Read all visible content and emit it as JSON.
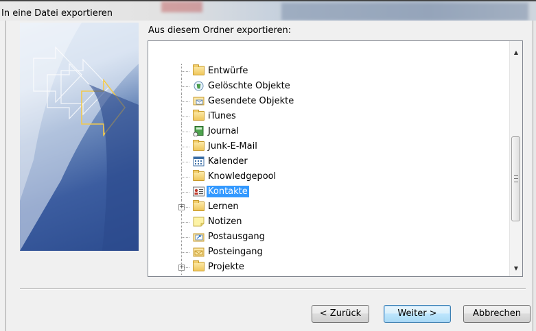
{
  "window": {
    "title": "In eine Datei exportieren"
  },
  "main": {
    "folder_label": "Aus diesem Ordner exportieren:"
  },
  "tree": {
    "selected": "Kontakte",
    "items": [
      {
        "label": "Entwürfe",
        "icon": "folder-icon",
        "expandable": false
      },
      {
        "label": "Gelöschte Objekte",
        "icon": "deleted-items-icon",
        "expandable": false
      },
      {
        "label": "Gesendete Objekte",
        "icon": "sent-items-icon",
        "expandable": false
      },
      {
        "label": "iTunes",
        "icon": "folder-icon",
        "expandable": false
      },
      {
        "label": "Journal",
        "icon": "journal-icon",
        "expandable": false
      },
      {
        "label": "Junk-E-Mail",
        "icon": "folder-icon",
        "expandable": false
      },
      {
        "label": "Kalender",
        "icon": "calendar-icon",
        "expandable": false
      },
      {
        "label": "Knowledgepool",
        "icon": "folder-icon",
        "expandable": false
      },
      {
        "label": "Kontakte",
        "icon": "contacts-icon",
        "expandable": false
      },
      {
        "label": "Lernen",
        "icon": "folder-icon",
        "expandable": true
      },
      {
        "label": "Notizen",
        "icon": "notes-icon",
        "expandable": false
      },
      {
        "label": "Postausgang",
        "icon": "outbox-icon",
        "expandable": false
      },
      {
        "label": "Posteingang",
        "icon": "inbox-icon",
        "expandable": false
      },
      {
        "label": "Projekte",
        "icon": "folder-icon",
        "expandable": true
      }
    ]
  },
  "buttons": {
    "back": "< Zurück",
    "next": "Weiter >",
    "cancel": "Abbrechen"
  },
  "colors": {
    "selection": "#3399ff",
    "dialog_bg": "#f0f0f0"
  }
}
